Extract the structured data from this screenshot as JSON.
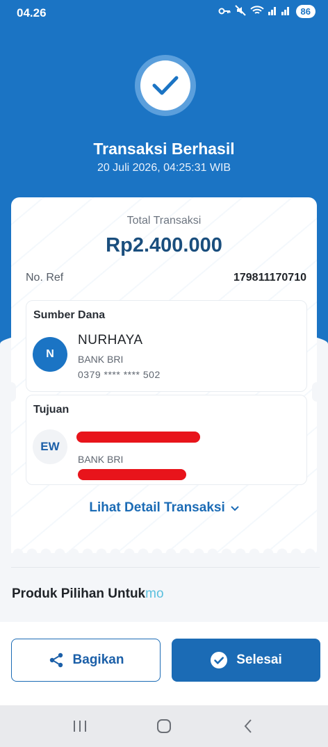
{
  "status_bar": {
    "time": "04.26",
    "battery": "86"
  },
  "header": {
    "title": "Transaksi Berhasil",
    "datetime": "20 Juli 2026, 04:25:31 WIB"
  },
  "receipt": {
    "total_label": "Total Transaksi",
    "total_amount": "Rp2.400.000",
    "ref_label": "No. Ref",
    "ref_value": "179811170710",
    "source": {
      "title": "Sumber Dana",
      "avatar_initial": "N",
      "name": "NURHAYA",
      "bank": "BANK BRI",
      "account_number": "0379 **** **** 502"
    },
    "destination": {
      "title": "Tujuan",
      "avatar_initial": "EW",
      "bank": "BANK BRI"
    },
    "detail_link": "Lihat Detail Transaksi"
  },
  "products": {
    "title": "Produk Pilihan Untuk",
    "brand_suffix": "mo"
  },
  "actions": {
    "share_label": "Bagikan",
    "done_label": "Selesai"
  },
  "colors": {
    "primary": "#1b74c4",
    "button": "#1b6bb5",
    "redaction": "#e8141b"
  },
  "icons": {
    "status": [
      "key-icon",
      "mute-icon",
      "wifi-icon",
      "signal-icon"
    ],
    "success": "check-icon",
    "share": "share-icon",
    "done": "check-circle-icon",
    "nav": [
      "recents-icon",
      "home-icon",
      "back-icon"
    ]
  }
}
